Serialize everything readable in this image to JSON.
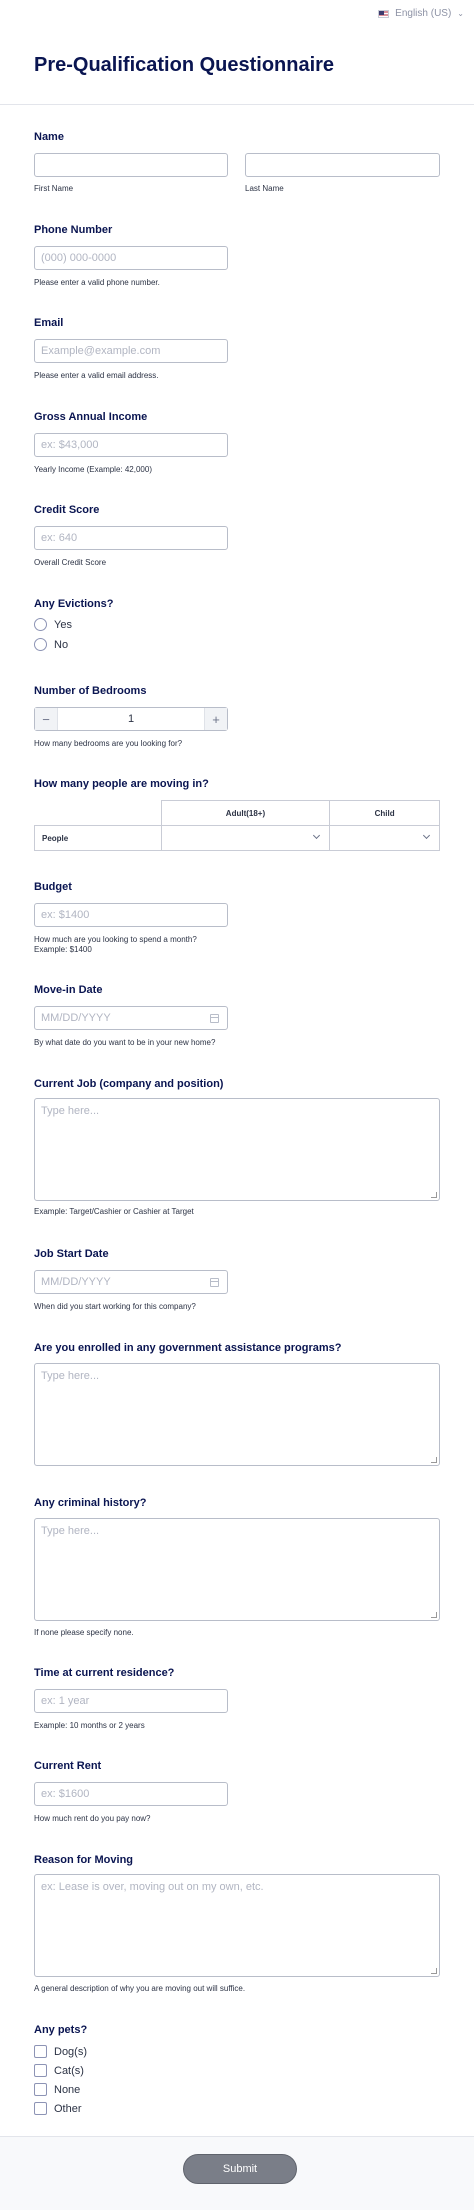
{
  "header": {
    "language": "English (US)",
    "title": "Pre-Qualification Questionnaire"
  },
  "name": {
    "label": "Name",
    "first_sub": "First Name",
    "last_sub": "Last Name"
  },
  "phone": {
    "label": "Phone Number",
    "placeholder": "(000) 000-0000",
    "sub": "Please enter a valid phone number."
  },
  "email": {
    "label": "Email",
    "placeholder": "Example@example.com",
    "sub": "Please enter a valid email address."
  },
  "income": {
    "label": "Gross Annual Income",
    "placeholder": "ex: $43,000",
    "sub": "Yearly Income (Example: 42,000)"
  },
  "credit": {
    "label": "Credit Score",
    "placeholder": "ex: 640",
    "sub": "Overall Credit Score"
  },
  "evictions": {
    "label": "Any Evictions?",
    "options": [
      "Yes",
      "No"
    ]
  },
  "bedrooms": {
    "label": "Number of Bedrooms",
    "minus": "−",
    "value": "1",
    "plus": "+",
    "sub": "How many bedrooms are you looking for?"
  },
  "moving": {
    "label": "How many people are moving in?",
    "col1": "Adult(18+)",
    "col2": "Child",
    "row": "People"
  },
  "budget": {
    "label": "Budget",
    "placeholder": "ex: $1400",
    "sub1": "How much are you looking to spend a month?",
    "sub2": "Example: $1400"
  },
  "movein": {
    "label": "Move-in Date",
    "placeholder": "MM/DD/YYYY",
    "sub": "By what date do you want to be in your new home?"
  },
  "job": {
    "label": "Current Job (company and position)",
    "placeholder": "Type here...",
    "sub": "Example: Target/Cashier or Cashier at Target"
  },
  "jobstart": {
    "label": "Job Start Date",
    "placeholder": "MM/DD/YYYY",
    "sub": "When did you start working for this company?"
  },
  "assistance": {
    "label": "Are you enrolled in any government assistance programs?",
    "placeholder": "Type here..."
  },
  "criminal": {
    "label": "Any criminal history?",
    "placeholder": "Type here...",
    "sub": "If none please specify none."
  },
  "residence": {
    "label": "Time at current residence?",
    "placeholder": "ex: 1 year",
    "sub": "Example: 10 months or 2 years"
  },
  "rent": {
    "label": "Current Rent",
    "placeholder": "ex: $1600",
    "sub": "How much rent do you pay now?"
  },
  "reason": {
    "label": "Reason for Moving",
    "placeholder": "ex: Lease is over, moving out on my own, etc.",
    "sub": "A general description of why you are moving out will suffice."
  },
  "pets": {
    "label": "Any pets?",
    "options": [
      "Dog(s)",
      "Cat(s)",
      "None",
      "Other"
    ]
  },
  "submit": {
    "label": "Submit"
  }
}
